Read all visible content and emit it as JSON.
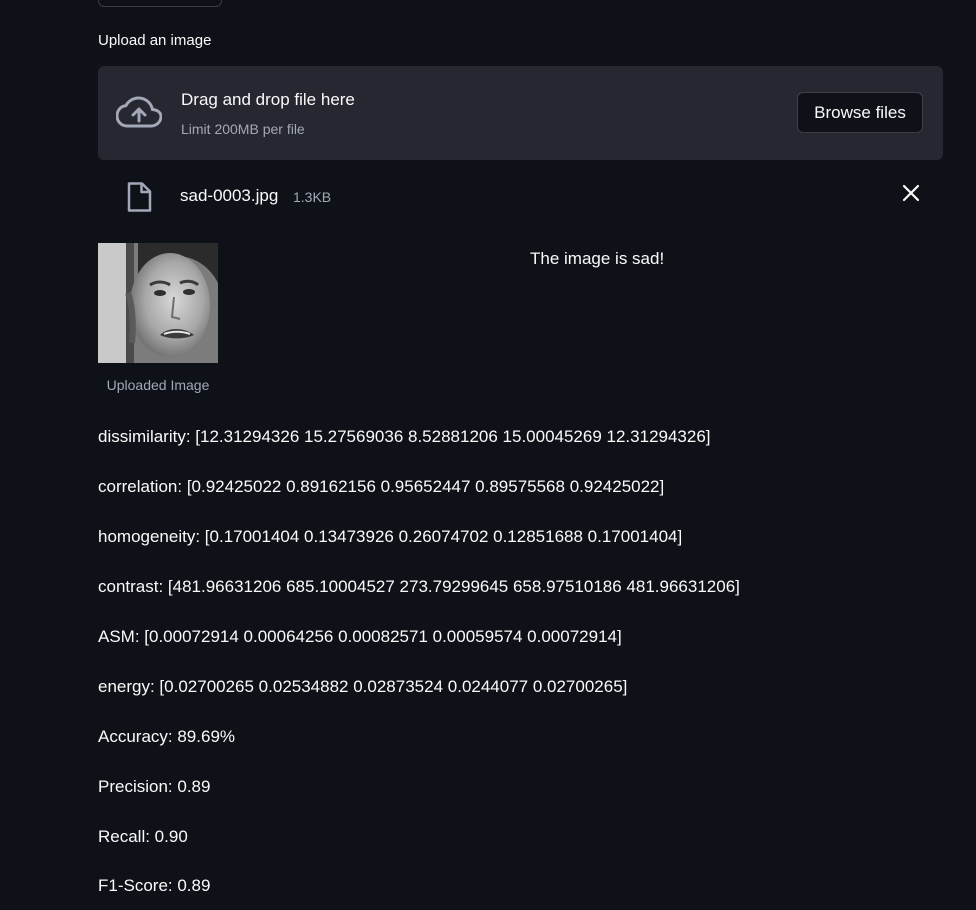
{
  "upload": {
    "label": "Upload an image",
    "drop_title": "Drag and drop file here",
    "drop_limit": "Limit 200MB per file",
    "browse_label": "Browse files"
  },
  "file": {
    "name": "sad-0003.jpg",
    "size": "1.3KB"
  },
  "image": {
    "caption": "Uploaded Image"
  },
  "result": {
    "text": "The image is sad!"
  },
  "metrics": [
    "dissimilarity: [12.31294326 15.27569036 8.52881206 15.00045269 12.31294326]",
    "correlation: [0.92425022 0.89162156 0.95652447 0.89575568 0.92425022]",
    "homogeneity: [0.17001404 0.13473926 0.26074702 0.12851688 0.17001404]",
    "contrast: [481.96631206 685.10004527 273.79299645 658.97510186 481.96631206]",
    "ASM: [0.00072914 0.00064256 0.00082571 0.00059574 0.00072914]",
    "energy: [0.02700265 0.02534882 0.02873524 0.0244077 0.02700265]",
    "Accuracy: 89.69%",
    "Precision: 0.89",
    "Recall: 0.90",
    "F1-Score: 0.89"
  ],
  "colors": {
    "background": "#0e1117",
    "dropzone": "#262730",
    "text": "#fafafa",
    "muted": "#a3a8b8"
  }
}
